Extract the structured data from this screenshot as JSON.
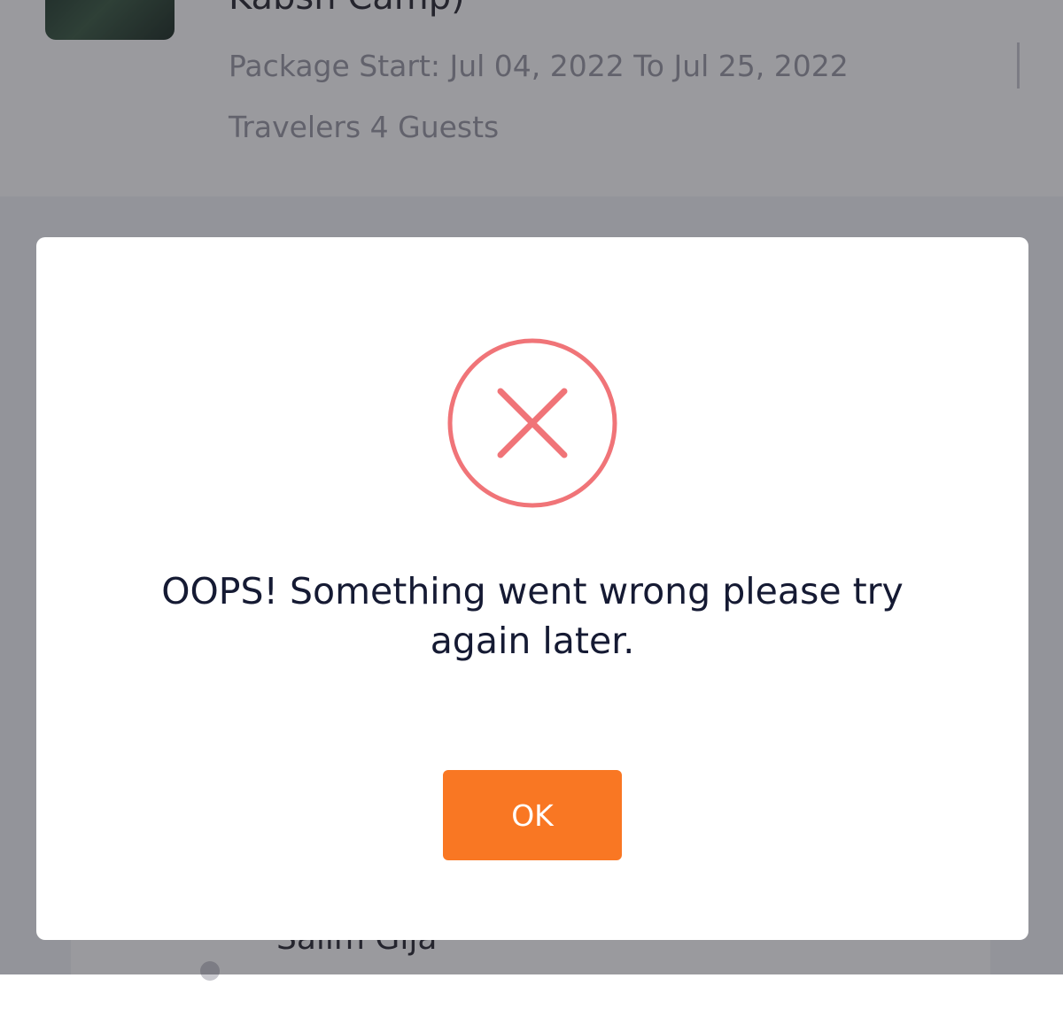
{
  "background": {
    "package_title": "Kabsh Camp)",
    "package_dates": "Package Start: Jul 04, 2022 To Jul 25, 2022",
    "travelers": "Travelers 4 Guests",
    "guest_name": "Salim Gija"
  },
  "modal": {
    "icon": "error-x-circle-icon",
    "message": "OOPS! Something went wrong please try again later.",
    "ok_label": "OK"
  },
  "colors": {
    "accent": "#f97723",
    "error": "#f07478",
    "text": "#151a33"
  }
}
